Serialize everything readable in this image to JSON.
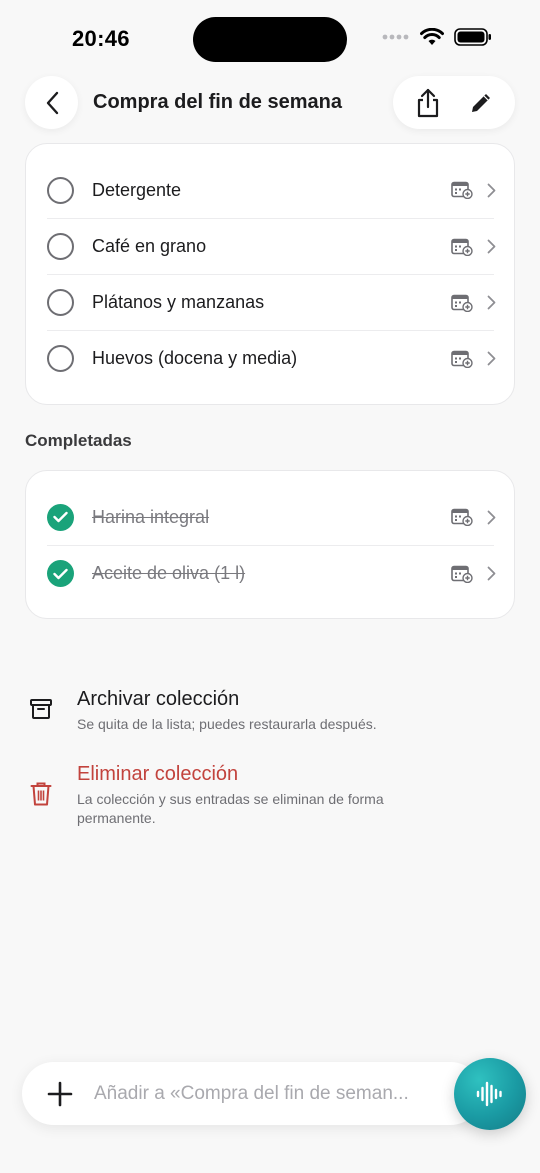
{
  "status_bar": {
    "time": "20:46"
  },
  "header": {
    "title": "Compra del fin de semana"
  },
  "open_items": [
    {
      "label": "Detergente"
    },
    {
      "label": "Café en grano"
    },
    {
      "label": "Plátanos y manzanas"
    },
    {
      "label": "Huevos (docena y media)"
    }
  ],
  "completed": {
    "heading": "Completadas",
    "items": [
      {
        "label": "Harina integral"
      },
      {
        "label": "Aceite de oliva (1 l)"
      }
    ]
  },
  "actions": {
    "archive": {
      "title": "Archivar colección",
      "subtitle": "Se quita de la lista; puedes restaurarla después."
    },
    "delete": {
      "title": "Eliminar colección",
      "subtitle": "La colección y sus entradas se eliminan de forma permanente."
    }
  },
  "composer": {
    "placeholder": "Añadir a «Compra del fin de seman..."
  },
  "colors": {
    "accent": "#1aa37a",
    "danger": "#c2433d",
    "voice": "#1a9aa3"
  },
  "icons": [
    "back-icon",
    "share-icon",
    "edit-icon",
    "calendar-add-icon",
    "chevron-right-icon",
    "archive-icon",
    "trash-icon",
    "plus-icon",
    "waveform-icon"
  ]
}
